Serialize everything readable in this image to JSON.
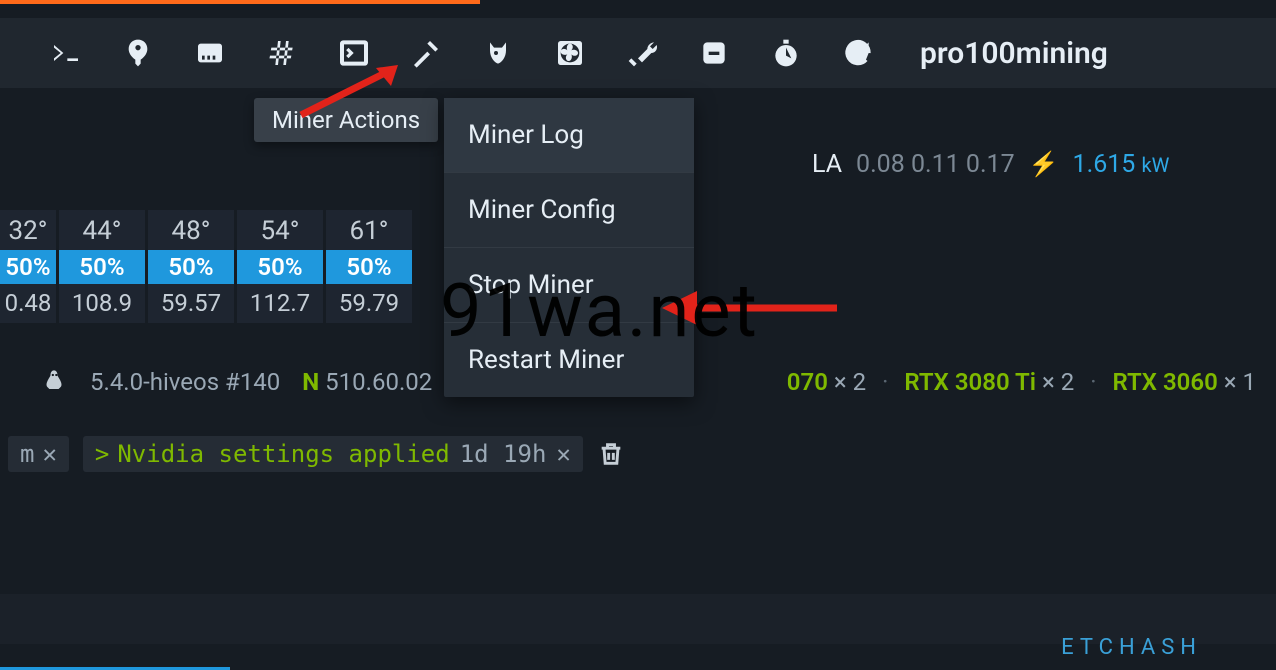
{
  "rig_name": "pro100mining",
  "tooltip_label": "Miner Actions",
  "dropdown": {
    "items": [
      "Miner Log",
      "Miner Config",
      "Stop Miner",
      "Restart Miner"
    ]
  },
  "la": {
    "label": "LA",
    "values": "0.08 0.11 0.17"
  },
  "power": {
    "value": "1.615",
    "unit": "kW"
  },
  "gpus": [
    {
      "temp": "32°",
      "fan": "50%",
      "power": "0.48"
    },
    {
      "temp": "44°",
      "fan": "50%",
      "power": "108.9"
    },
    {
      "temp": "48°",
      "fan": "50%",
      "power": "59.57"
    },
    {
      "temp": "54°",
      "fan": "50%",
      "power": "112.7"
    },
    {
      "temp": "61°",
      "fan": "50%",
      "power": "59.79"
    }
  ],
  "system": {
    "kernel": "5.4.0-hiveos #140",
    "nvidia_prefix": "N",
    "driver": "510.60.02"
  },
  "gpu_models": [
    {
      "name": "070",
      "count": "× 2"
    },
    {
      "name": "RTX 3080 Ti",
      "count": "× 2"
    },
    {
      "name": "RTX 3060",
      "count": "× 1"
    }
  ],
  "log": {
    "truncated_suffix": "m",
    "prompt": ">",
    "message": "Nvidia settings applied",
    "age": "1d 19h"
  },
  "algo": "ETCHASH",
  "watermark": "91wa.net"
}
